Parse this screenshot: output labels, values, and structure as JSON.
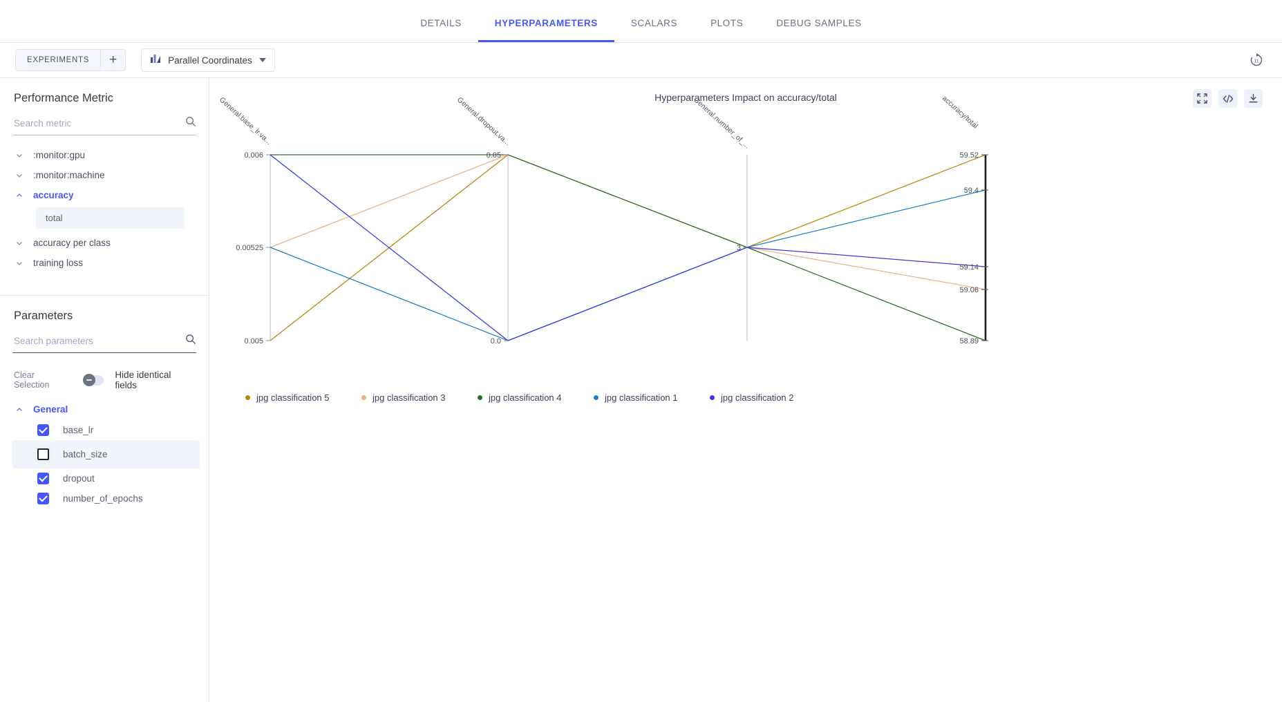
{
  "header": {
    "tabs": [
      {
        "label": "DETAILS",
        "active": false
      },
      {
        "label": "HYPERPARAMETERS",
        "active": true
      },
      {
        "label": "SCALARS",
        "active": false
      },
      {
        "label": "PLOTS",
        "active": false
      },
      {
        "label": "DEBUG SAMPLES",
        "active": false
      }
    ]
  },
  "toolbar": {
    "experiments_label": "EXPERIMENTS",
    "add_label": "+",
    "plot_type": "Parallel Coordinates",
    "refresh_icon": "refresh-icon"
  },
  "sidebar": {
    "metric_panel": {
      "title": "Performance Metric",
      "search_placeholder": "Search metric",
      "search_value": "",
      "search_icon": "search-icon",
      "items": [
        {
          "label": ":monitor:gpu",
          "expanded": false,
          "accent": false
        },
        {
          "label": ":monitor:machine",
          "expanded": false,
          "accent": false
        },
        {
          "label": "accuracy",
          "expanded": true,
          "accent": true,
          "children": [
            "total"
          ]
        },
        {
          "label": "accuracy per class",
          "expanded": false,
          "accent": false
        },
        {
          "label": "training loss",
          "expanded": false,
          "accent": false
        }
      ]
    },
    "params_panel": {
      "title": "Parameters",
      "search_placeholder": "Search parameters",
      "search_value": "",
      "search_icon": "search-icon",
      "clear_selection_label": "Clear Selection",
      "hide_identical_label": "Hide identical fields",
      "hide_identical_on": false,
      "group_label": "General",
      "group_expanded": true,
      "params": [
        {
          "label": "base_lr",
          "checked": true,
          "highlighted": false
        },
        {
          "label": "batch_size",
          "checked": false,
          "highlighted": true
        },
        {
          "label": "dropout",
          "checked": true,
          "highlighted": false
        },
        {
          "label": "number_of_epochs",
          "checked": true,
          "highlighted": false
        }
      ]
    }
  },
  "chart": {
    "title": "Hyperparameters Impact on accuracy/total",
    "tools": [
      {
        "name": "fullscreen-icon"
      },
      {
        "name": "code-icon"
      },
      {
        "name": "download-icon"
      }
    ]
  },
  "chart_data": {
    "type": "line",
    "subtype": "parallel-coordinates",
    "title": "Hyperparameters Impact on accuracy/total",
    "axes": [
      {
        "key": "base_lr",
        "label": "General.base_lr.va...",
        "ticks": [
          "0.006",
          "0.00525",
          "0.005"
        ],
        "tick_values": [
          0.006,
          0.00525,
          0.005
        ],
        "min": 0.005,
        "max": 0.006
      },
      {
        "key": "dropout",
        "label": "General.dropout.va...",
        "ticks": [
          "0.05",
          "0.0"
        ],
        "tick_values": [
          0.05,
          0.0
        ],
        "min": 0.0,
        "max": 0.05
      },
      {
        "key": "number_of_epochs",
        "label": "General.number_of_...",
        "ticks": [
          "3"
        ],
        "tick_values": [
          3
        ],
        "min": 3,
        "max": 3
      },
      {
        "key": "accuracy_total",
        "label": "accuracy/total",
        "ticks": [
          "59.52",
          "59.4",
          "59.14",
          "59.06",
          "58.89"
        ],
        "tick_values": [
          59.52,
          59.4,
          59.14,
          59.06,
          58.89
        ],
        "min": 58.89,
        "max": 59.52
      }
    ],
    "series": [
      {
        "name": "jpg classification 5",
        "color": "#b8860b",
        "values": {
          "base_lr": 0.005,
          "dropout": 0.05,
          "number_of_epochs": 3,
          "accuracy_total": 59.52
        }
      },
      {
        "name": "jpg classification 3",
        "color": "#e8b38a",
        "values": {
          "base_lr": 0.00525,
          "dropout": 0.05,
          "number_of_epochs": 3,
          "accuracy_total": 59.06
        }
      },
      {
        "name": "jpg classification 4",
        "color": "#2d6b2d",
        "values": {
          "base_lr": 0.006,
          "dropout": 0.05,
          "number_of_epochs": 3,
          "accuracy_total": 58.89
        }
      },
      {
        "name": "jpg classification 1",
        "color": "#1a7fc1",
        "values": {
          "base_lr": 0.00525,
          "dropout": 0.0,
          "number_of_epochs": 3,
          "accuracy_total": 59.4
        }
      },
      {
        "name": "jpg classification 2",
        "color": "#3a3ae0",
        "values": {
          "base_lr": 0.006,
          "dropout": 0.0,
          "number_of_epochs": 3,
          "accuracy_total": 59.14
        }
      }
    ],
    "legend_position": "bottom",
    "grid": false
  }
}
